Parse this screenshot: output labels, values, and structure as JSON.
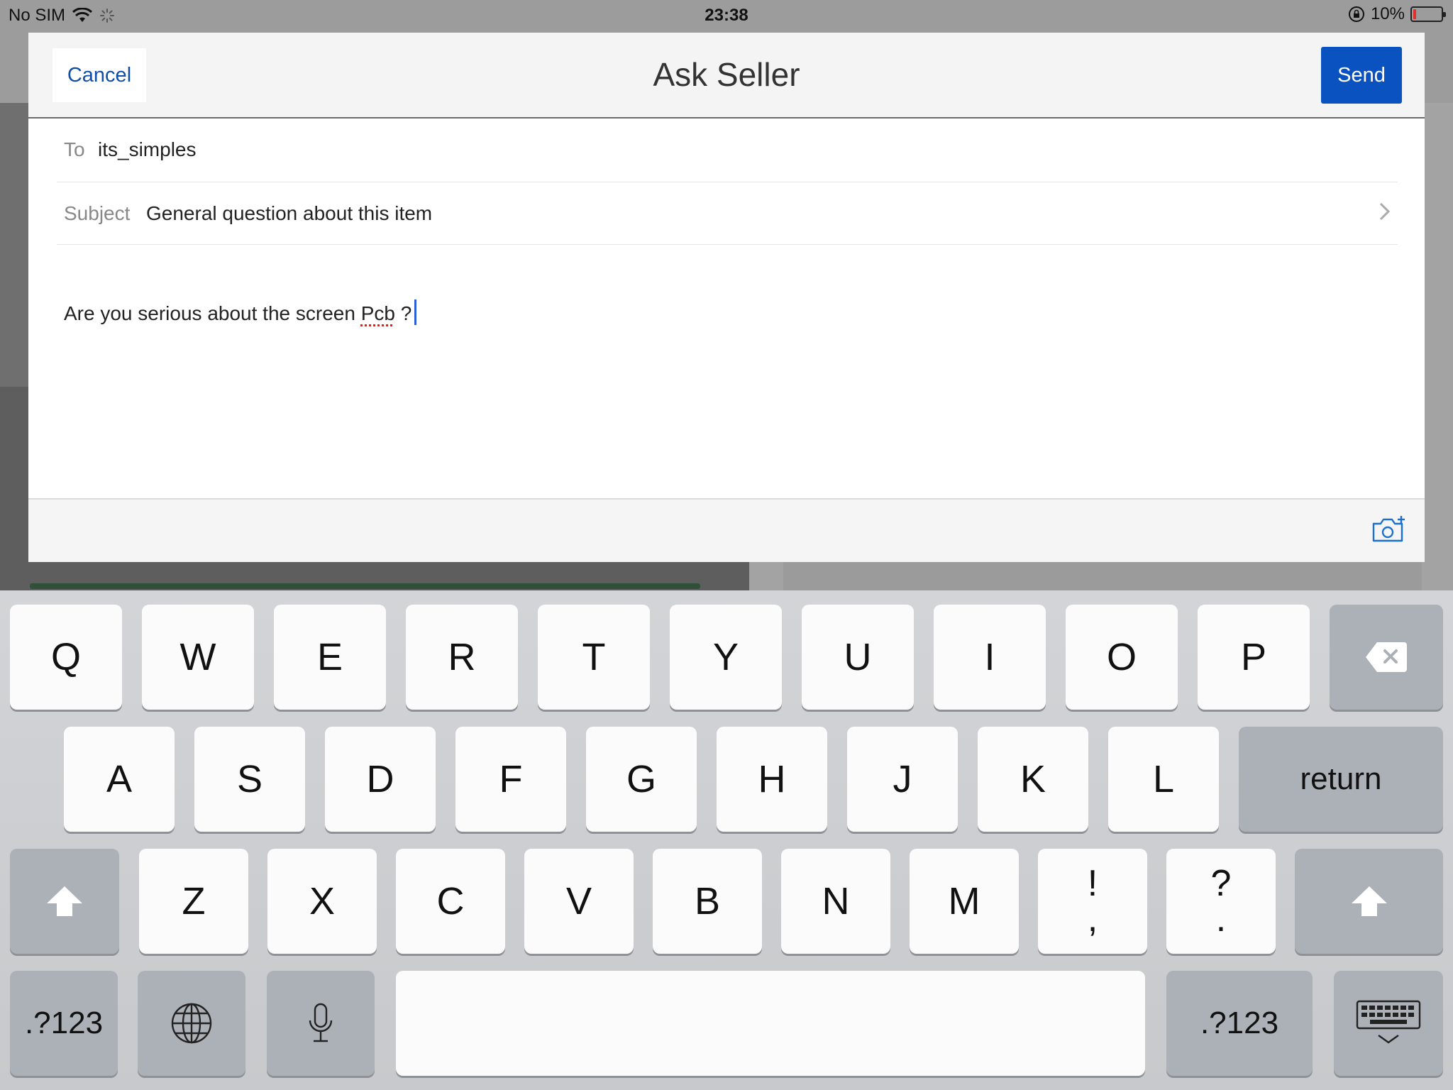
{
  "status_bar": {
    "carrier": "No SIM",
    "time": "23:38",
    "battery_percent": "10%",
    "battery_level": 0.1,
    "battery_color": "#e0302a"
  },
  "header": {
    "cancel_label": "Cancel",
    "title": "Ask Seller",
    "send_label": "Send"
  },
  "form": {
    "to_label": "To",
    "to_value": "its_simples",
    "subject_label": "Subject",
    "subject_value": "General question about this item",
    "message_before": "Are you serious about the screen ",
    "message_misspelled": "Pcb",
    "message_after": " ?"
  },
  "keyboard": {
    "row1": [
      "Q",
      "W",
      "E",
      "R",
      "T",
      "Y",
      "U",
      "I",
      "O",
      "P"
    ],
    "row2": [
      "A",
      "S",
      "D",
      "F",
      "G",
      "H",
      "J",
      "K",
      "L"
    ],
    "return_label": "return",
    "row3": [
      "Z",
      "X",
      "C",
      "V",
      "B",
      "N",
      "M"
    ],
    "punct1_top": "!",
    "punct1_bottom": ",",
    "punct2_top": "?",
    "punct2_bottom": ".",
    "numbers_label": ".?123"
  },
  "colors": {
    "accent": "#0b52c1",
    "link": "#0f4fa8"
  }
}
